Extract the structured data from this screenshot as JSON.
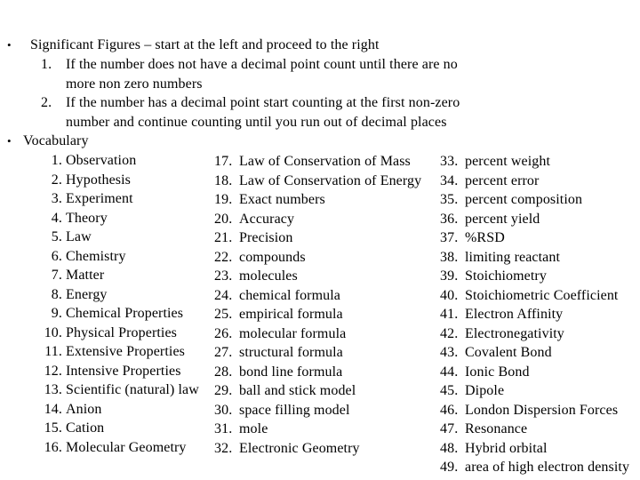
{
  "sig_figs": {
    "heading": "Significant Figures – start at the left and proceed to the right",
    "rules": [
      {
        "num": "1.",
        "line1": "If the number does not have a decimal point count until there are no",
        "line2": "more non zero numbers"
      },
      {
        "num": "2.",
        "line1": "If the number has a decimal point start counting at the first non-zero",
        "line2": "number and continue counting until you run out of  decimal places"
      }
    ]
  },
  "vocabulary": {
    "heading": "Vocabulary",
    "column1": [
      {
        "num": "1.",
        "term": "Observation"
      },
      {
        "num": "2.",
        "term": "Hypothesis"
      },
      {
        "num": "3.",
        "term": "Experiment"
      },
      {
        "num": "4.",
        "term": "Theory"
      },
      {
        "num": "5.",
        "term": "Law"
      },
      {
        "num": "6.",
        "term": "Chemistry"
      },
      {
        "num": "7.",
        "term": "Matter"
      },
      {
        "num": "8.",
        "term": "Energy"
      },
      {
        "num": "9.",
        "term": "Chemical Properties"
      },
      {
        "num": "10.",
        "term": "Physical Properties"
      },
      {
        "num": "11.",
        "term": "Extensive Properties"
      },
      {
        "num": "12.",
        "term": "Intensive Properties"
      },
      {
        "num": "13.",
        "term": "Scientific (natural) law"
      },
      {
        "num": "14.",
        "term": "Anion"
      },
      {
        "num": "15.",
        "term": "Cation"
      },
      {
        "num": "16.",
        "term": "Molecular Geometry"
      }
    ],
    "column2": [
      {
        "num": "17.",
        "term": "Law of Conservation of Mass"
      },
      {
        "num": "18.",
        "term": "Law of Conservation of Energy"
      },
      {
        "num": "19.",
        "term": "Exact numbers"
      },
      {
        "num": "20.",
        "term": "Accuracy"
      },
      {
        "num": "21.",
        "term": "Precision"
      },
      {
        "num": "22.",
        "term": "compounds"
      },
      {
        "num": "23.",
        "term": "molecules"
      },
      {
        "num": "24.",
        "term": "chemical formula"
      },
      {
        "num": "25.",
        "term": "empirical formula"
      },
      {
        "num": "26.",
        "term": "molecular formula"
      },
      {
        "num": "27.",
        "term": "structural formula"
      },
      {
        "num": "28.",
        "term": "bond line formula"
      },
      {
        "num": "29.",
        "term": "ball and stick model"
      },
      {
        "num": "30.",
        "term": "space filling model"
      },
      {
        "num": "31.",
        "term": "mole"
      },
      {
        "num": "32.",
        "term": "Electronic Geometry"
      }
    ],
    "column3": [
      {
        "num": "33.",
        "term": "percent weight"
      },
      {
        "num": "34.",
        "term": "percent error"
      },
      {
        "num": "35.",
        "term": "percent composition"
      },
      {
        "num": "36.",
        "term": "percent yield"
      },
      {
        "num": "37.",
        "term": "%RSD"
      },
      {
        "num": "38.",
        "term": "limiting reactant"
      },
      {
        "num": "39.",
        "term": "Stoichiometry"
      },
      {
        "num": "40.",
        "term": "Stoichiometric Coefficient"
      },
      {
        "num": "41.",
        "term": "Electron Affinity"
      },
      {
        "num": "42.",
        "term": "Electronegativity"
      },
      {
        "num": "43.",
        "term": "Covalent Bond"
      },
      {
        "num": "44.",
        "term": "Ionic Bond"
      },
      {
        "num": "45.",
        "term": "Dipole"
      },
      {
        "num": "46.",
        "term": "London Dispersion Forces"
      },
      {
        "num": "47.",
        "term": "Resonance"
      },
      {
        "num": "48.",
        "term": "Hybrid orbital"
      },
      {
        "num": "49.",
        "term": "area of high electron density"
      }
    ]
  }
}
